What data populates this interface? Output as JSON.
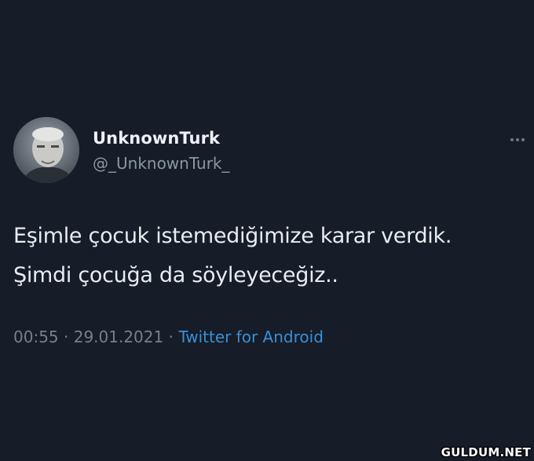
{
  "tweet": {
    "display_name": "UnknownTurk",
    "handle": "@_UnknownTurk_",
    "text_lines": [
      "Eşimle çocuk istemediğimize karar verdik.",
      "Şimdi çocuğa da söyleyeceğiz.."
    ],
    "time": "00:55",
    "separator": "·",
    "date": "29.01.2021",
    "source": "Twitter for Android",
    "more_icon": "more-horizontal-icon"
  },
  "watermark": "GULDUM.NET",
  "colors": {
    "background": "#161c28",
    "text": "#e9ecf0",
    "secondary": "#8b97a5",
    "link": "#3b8fd6"
  }
}
